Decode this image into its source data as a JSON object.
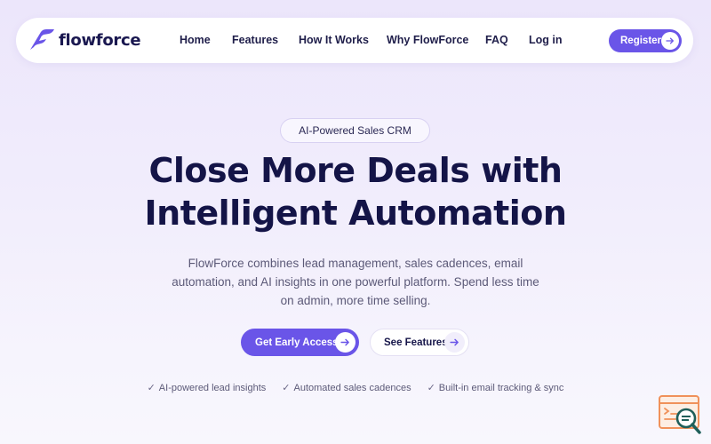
{
  "brand": {
    "name": "flowforce"
  },
  "nav": {
    "links": [
      "Home",
      "Features",
      "How It Works",
      "Why FlowForce",
      "FAQ",
      "Log in"
    ],
    "register_label": "Register"
  },
  "hero": {
    "badge": "AI-Powered Sales CRM",
    "headline_line1": "Close More Deals with",
    "headline_line2": "Intelligent Automation",
    "subtext": "FlowForce combines lead management, sales cadences, email automation, and AI insights in one powerful platform. Spend less time on admin, more time selling.",
    "primary_cta": "Get Early Access",
    "secondary_cta": "See Features",
    "features": [
      "AI-powered lead insights",
      "Automated sales cadences",
      "Built-in email tracking & sync"
    ]
  },
  "icons": {
    "logo": "flowforce-logo-icon",
    "arrow": "arrow-right-icon",
    "check": "check-icon",
    "widget": "search-document-icon"
  },
  "colors": {
    "accent": "#6a55e8",
    "headline": "#141447",
    "body_text": "#5c5a78",
    "background": "#ece6fb",
    "widget_orange": "#f0915a",
    "widget_teal": "#1f5f5a"
  }
}
